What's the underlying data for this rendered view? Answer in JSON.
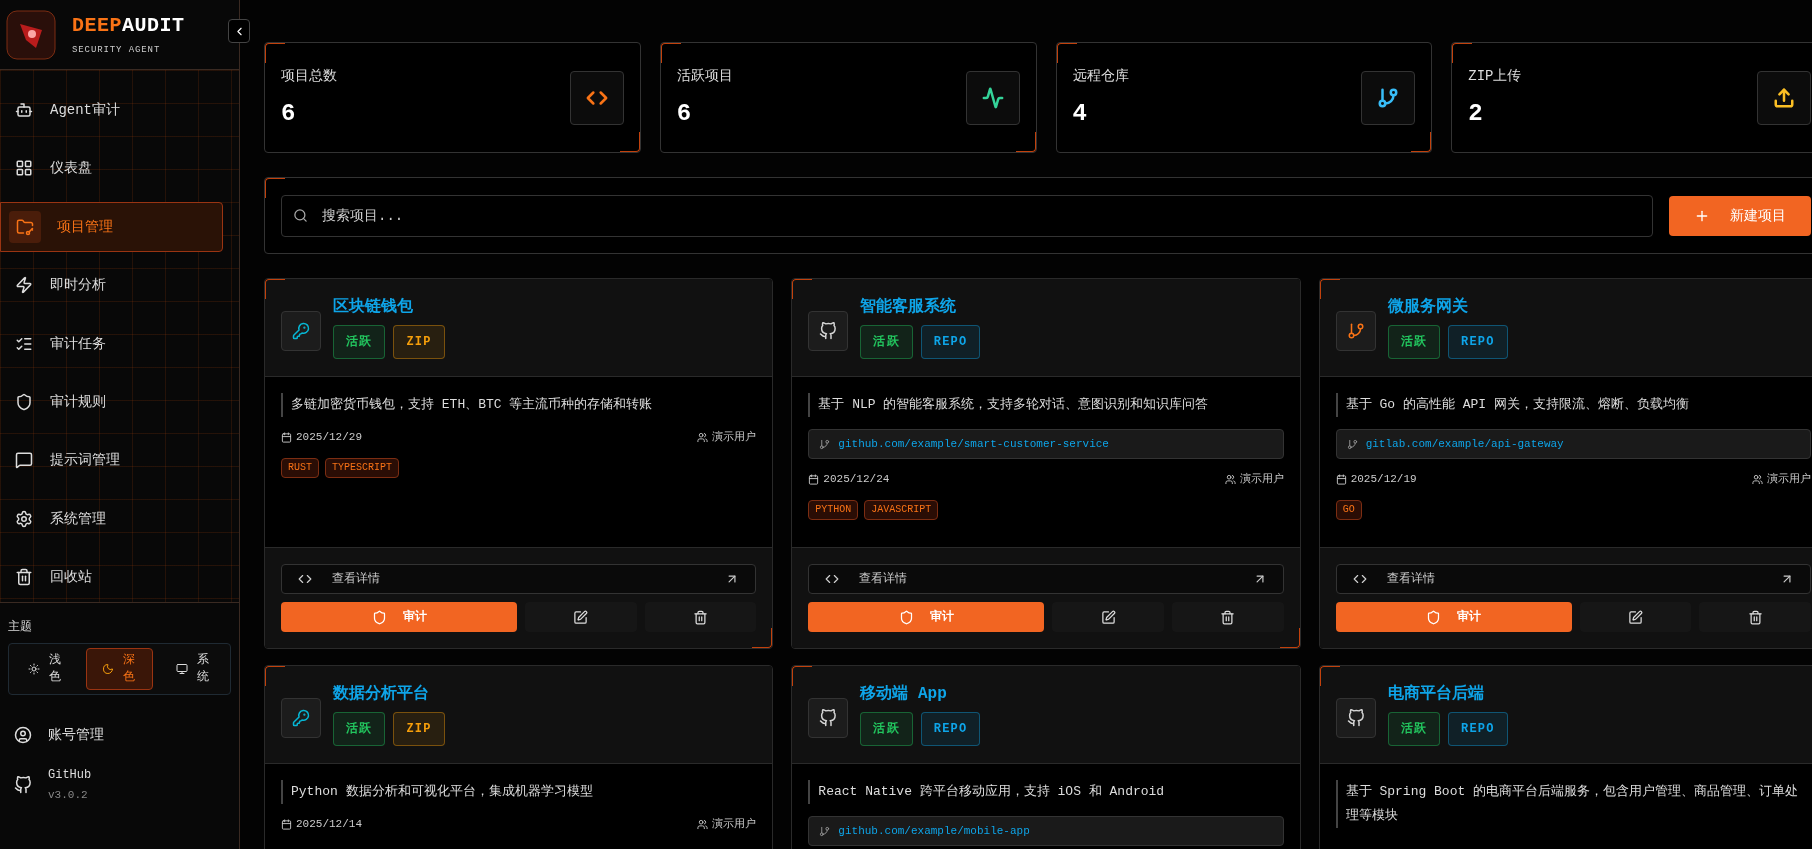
{
  "brand": {
    "name_accent": "DEEP",
    "name_rest": "AUDIT",
    "subtitle": "SECURITY AGENT"
  },
  "sidebar": {
    "items": [
      {
        "label": "Agent审计",
        "selected": false
      },
      {
        "label": "仪表盘",
        "selected": false
      },
      {
        "label": "项目管理",
        "selected": true
      },
      {
        "label": "即时分析",
        "selected": false
      },
      {
        "label": "审计任务",
        "selected": false
      },
      {
        "label": "审计规则",
        "selected": false
      },
      {
        "label": "提示词管理",
        "selected": false
      },
      {
        "label": "系统管理",
        "selected": false
      },
      {
        "label": "回收站",
        "selected": false
      }
    ],
    "theme_label": "主题",
    "themes": [
      {
        "label": "浅色",
        "selected": false
      },
      {
        "label": "深色",
        "selected": true
      },
      {
        "label": "系统",
        "selected": false
      }
    ],
    "account": "账号管理",
    "github": "GitHub",
    "version": "v3.0.2"
  },
  "stats": [
    {
      "label": "项目总数",
      "value": "6",
      "color": "#f97316"
    },
    {
      "label": "活跃项目",
      "value": "6",
      "color": "#34d399"
    },
    {
      "label": "远程仓库",
      "value": "4",
      "color": "#38bdf8"
    },
    {
      "label": "ZIP上传",
      "value": "2",
      "color": "#fbbf24"
    }
  ],
  "search": {
    "placeholder": "搜索项目..."
  },
  "new_button": "新建项目",
  "projects": [
    {
      "kind": "zip",
      "name": "区块链钱包",
      "badges": [
        {
          "label": "活跃",
          "color": "#22c55e"
        },
        {
          "label": "ZIP",
          "color": "#f59e0b"
        }
      ],
      "description": "多链加密货币钱包，支持 ETH、BTC 等主流币种的存储和转账",
      "date": "2025/12/29",
      "owner": "演示用户",
      "tags": [
        "RUST",
        "TYPESCRIPT"
      ],
      "details": "查看详情",
      "audit": "审计"
    },
    {
      "kind": "github",
      "name": "智能客服系统",
      "badges": [
        {
          "label": "活跃",
          "color": "#22c55e"
        },
        {
          "label": "REPO",
          "color": "#0ea5e9"
        }
      ],
      "description": "基于 NLP 的智能客服系统，支持多轮对话、意图识别和知识库问答",
      "url": "github.com/example/smart-customer-service",
      "date": "2025/12/24",
      "owner": "演示用户",
      "tags": [
        "PYTHON",
        "JAVASCRIPT"
      ],
      "details": "查看详情",
      "audit": "审计"
    },
    {
      "kind": "gitlab",
      "name": "微服务网关",
      "badges": [
        {
          "label": "活跃",
          "color": "#22c55e"
        },
        {
          "label": "REPO",
          "color": "#0ea5e9"
        }
      ],
      "description": "基于 Go 的高性能 API 网关，支持限流、熔断、负载均衡",
      "url": "gitlab.com/example/api-gateway",
      "date": "2025/12/19",
      "owner": "演示用户",
      "tags": [
        "GO"
      ],
      "details": "查看详情",
      "audit": "审计"
    },
    {
      "kind": "zip",
      "name": "数据分析平台",
      "badges": [
        {
          "label": "活跃",
          "color": "#22c55e"
        },
        {
          "label": "ZIP",
          "color": "#f59e0b"
        }
      ],
      "description": "Python 数据分析和可视化平台，集成机器学习模型",
      "date": "2025/12/14",
      "owner": "演示用户"
    },
    {
      "kind": "github",
      "name": "移动端 App",
      "badges": [
        {
          "label": "活跃",
          "color": "#22c55e"
        },
        {
          "label": "REPO",
          "color": "#0ea5e9"
        }
      ],
      "description": "React Native 跨平台移动应用，支持 iOS 和 Android",
      "url": "github.com/example/mobile-app"
    },
    {
      "kind": "github",
      "name": "电商平台后端",
      "badges": [
        {
          "label": "活跃",
          "color": "#22c55e"
        },
        {
          "label": "REPO",
          "color": "#0ea5e9"
        }
      ],
      "description": "基于 Spring Boot 的电商平台后端服务，包含用户管理、商品管理、订单处理等模块"
    }
  ]
}
